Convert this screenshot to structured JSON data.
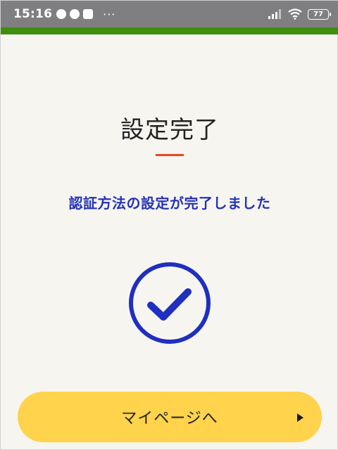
{
  "status_bar": {
    "time": "15:16",
    "battery": "77",
    "more": "···",
    "icons": [
      "notification-icon",
      "line-app-icon",
      "app-icon",
      "signal-icon",
      "wifi-icon",
      "battery-icon"
    ]
  },
  "page": {
    "title": "設定完了",
    "message": "認証方法の設定が完了しました"
  },
  "cta": {
    "label": "マイページへ"
  },
  "colors": {
    "accent_bar": "#3f8f0c",
    "underline": "#e8481f",
    "message_text": "#2332b8",
    "check": "#1f2fbf",
    "button": "#ffd34b",
    "background": "#f7f5f0"
  }
}
